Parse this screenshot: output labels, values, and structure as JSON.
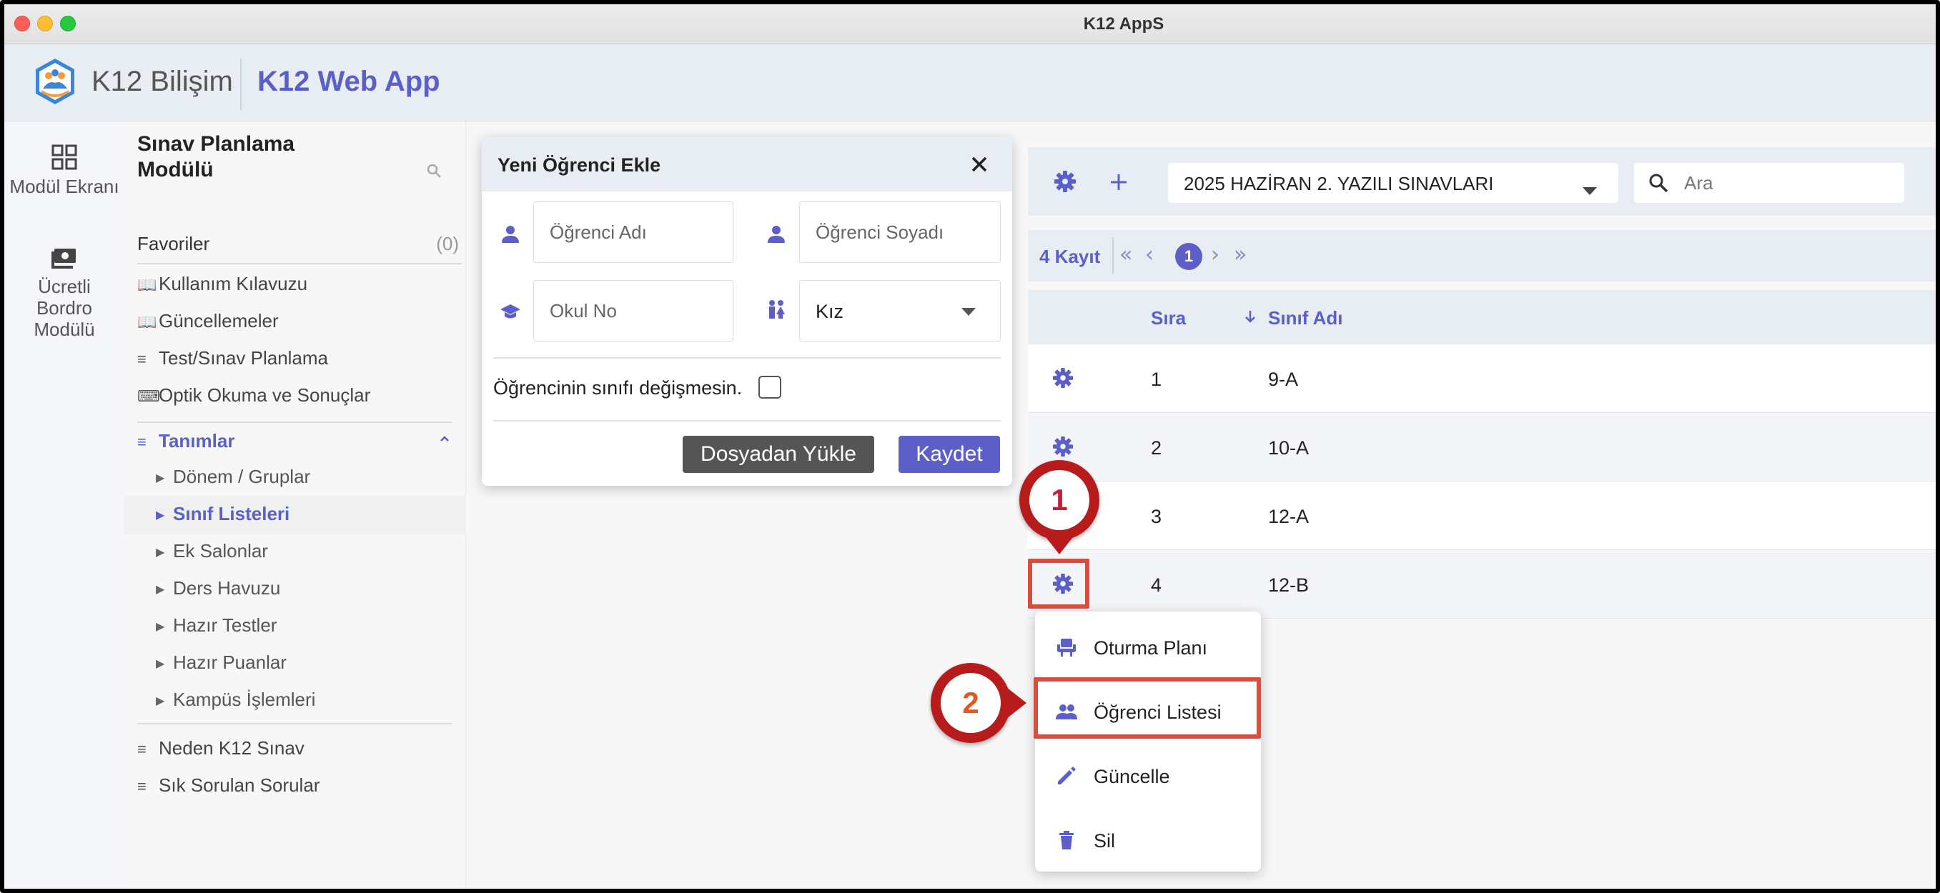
{
  "window": {
    "title": "K12 AppS"
  },
  "header": {
    "brand": "K12 Bilişim",
    "app_name": "K12 Web App"
  },
  "rail": [
    {
      "label": "Modül Ekranı",
      "icon": "grid-icon"
    },
    {
      "label": "Ücretli Bordro Modülü",
      "icon": "payroll-icon"
    }
  ],
  "sidebar": {
    "title": "Sınav Planlama Modülü",
    "favorites_label": "Favoriler",
    "favorites_count": "(0)",
    "items": [
      {
        "label": "Kullanım Kılavuzu",
        "icon": "book-icon"
      },
      {
        "label": "Güncellemeler",
        "icon": "book-icon"
      },
      {
        "label": "Test/Sınav Planlama",
        "icon": "menu-icon"
      },
      {
        "label": "Optik Okuma ve Sonuçlar",
        "icon": "scanner-icon"
      }
    ],
    "group": {
      "label": "Tanımlar",
      "children": [
        "Dönem / Gruplar",
        "Sınıf Listeleri",
        "Ek Salonlar",
        "Ders Havuzu",
        "Hazır Testler",
        "Hazır Puanlar",
        "Kampüs İşlemleri"
      ],
      "active": "Sınıf Listeleri"
    },
    "bottom_items": [
      {
        "label": "Neden K12 Sınav",
        "icon": "menu-icon"
      },
      {
        "label": "Sık Sorulan Sorular",
        "icon": "menu-icon"
      }
    ]
  },
  "dialog": {
    "title": "Yeni Öğrenci Ekle",
    "first_name_placeholder": "Öğrenci Adı",
    "last_name_placeholder": "Öğrenci Soyadı",
    "school_no_placeholder": "Okul No",
    "gender_value": "Kız",
    "keep_class_label": "Öğrencinin sınıfı değişmesin.",
    "upload_button": "Dosyadan Yükle",
    "save_button": "Kaydet"
  },
  "toolbar": {
    "exam_select_value": "2025 HAZİRAN 2. YAZILI SINAVLARI",
    "search_placeholder": "Ara"
  },
  "pager": {
    "record_count": "4 Kayıt",
    "current_page": "1"
  },
  "table": {
    "columns": [
      "Sıra",
      "Sınıf Adı"
    ],
    "rows": [
      {
        "sira": "1",
        "sinif": "9-A"
      },
      {
        "sira": "2",
        "sinif": "10-A"
      },
      {
        "sira": "3",
        "sinif": "12-A"
      },
      {
        "sira": "4",
        "sinif": "12-B"
      }
    ]
  },
  "context_menu": {
    "items": [
      {
        "label": "Oturma Planı",
        "icon": "seat-icon"
      },
      {
        "label": "Öğrenci Listesi",
        "icon": "people-icon"
      },
      {
        "label": "Güncelle",
        "icon": "pencil-icon"
      },
      {
        "label": "Sil",
        "icon": "trash-icon"
      }
    ]
  },
  "callouts": [
    "1",
    "2"
  ],
  "colors": {
    "accent": "#5b5fc7",
    "callout": "#b81b1b",
    "highlight": "#d94d3f",
    "header_bg": "#e8ecf3"
  }
}
